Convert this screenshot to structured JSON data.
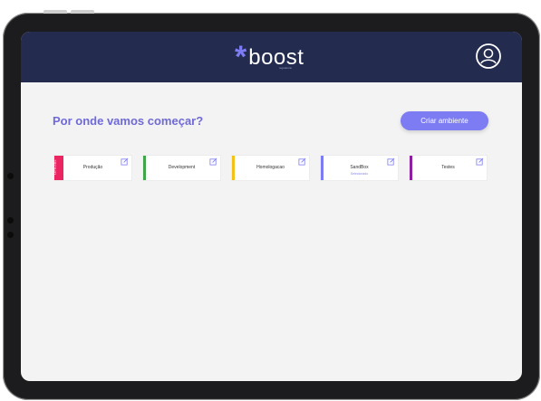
{
  "header": {
    "logo_text": "boost",
    "logo_subtext": "regulatório",
    "user_icon": "user-circle-icon"
  },
  "main": {
    "title": "Por onde vamos começar?",
    "create_button": "Criar ambiente"
  },
  "environments": [
    {
      "name": "Produção",
      "tag": "OFICIAL",
      "color": "#ea2561",
      "status": ""
    },
    {
      "name": "Development",
      "tag": "",
      "color": "#3fa64a",
      "status": ""
    },
    {
      "name": "Homologacao",
      "tag": "",
      "color": "#f3c21a",
      "status": ""
    },
    {
      "name": "SandBox",
      "tag": "",
      "color": "#7d7cf2",
      "status": "Selecionado"
    },
    {
      "name": "Testes",
      "tag": "",
      "color": "#8e1fa0",
      "status": ""
    }
  ],
  "icons": {
    "edit": "edit-icon",
    "user": "user-circle-icon"
  },
  "colors": {
    "header_bg": "#232b4f",
    "accent": "#7d7cf2",
    "official_tag": "#ea2561"
  }
}
